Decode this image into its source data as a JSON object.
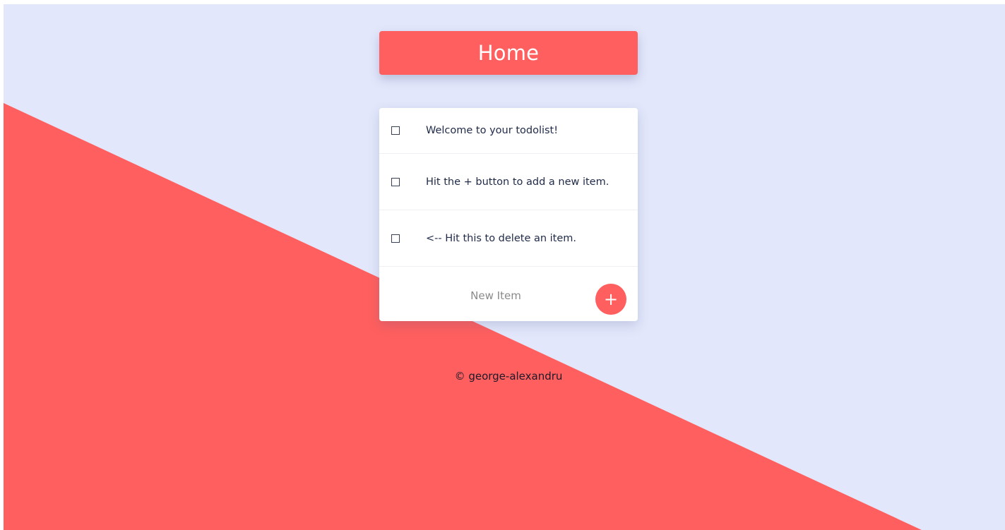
{
  "header": {
    "title": "Home"
  },
  "todo": {
    "items": [
      {
        "label": "Welcome to your todolist!",
        "checked": false
      },
      {
        "label": "Hit the + button to add a new item.",
        "checked": false
      },
      {
        "label": "<-- Hit this to delete an item.",
        "checked": false
      }
    ],
    "new_item": {
      "placeholder": "New Item",
      "value": "",
      "add_label": "+"
    }
  },
  "footer": {
    "text": "© george-alexandru"
  },
  "colors": {
    "accent": "#ff5f5e",
    "background": "#e2e7fb",
    "card": "#ffffff",
    "text": "#1f2a48"
  }
}
